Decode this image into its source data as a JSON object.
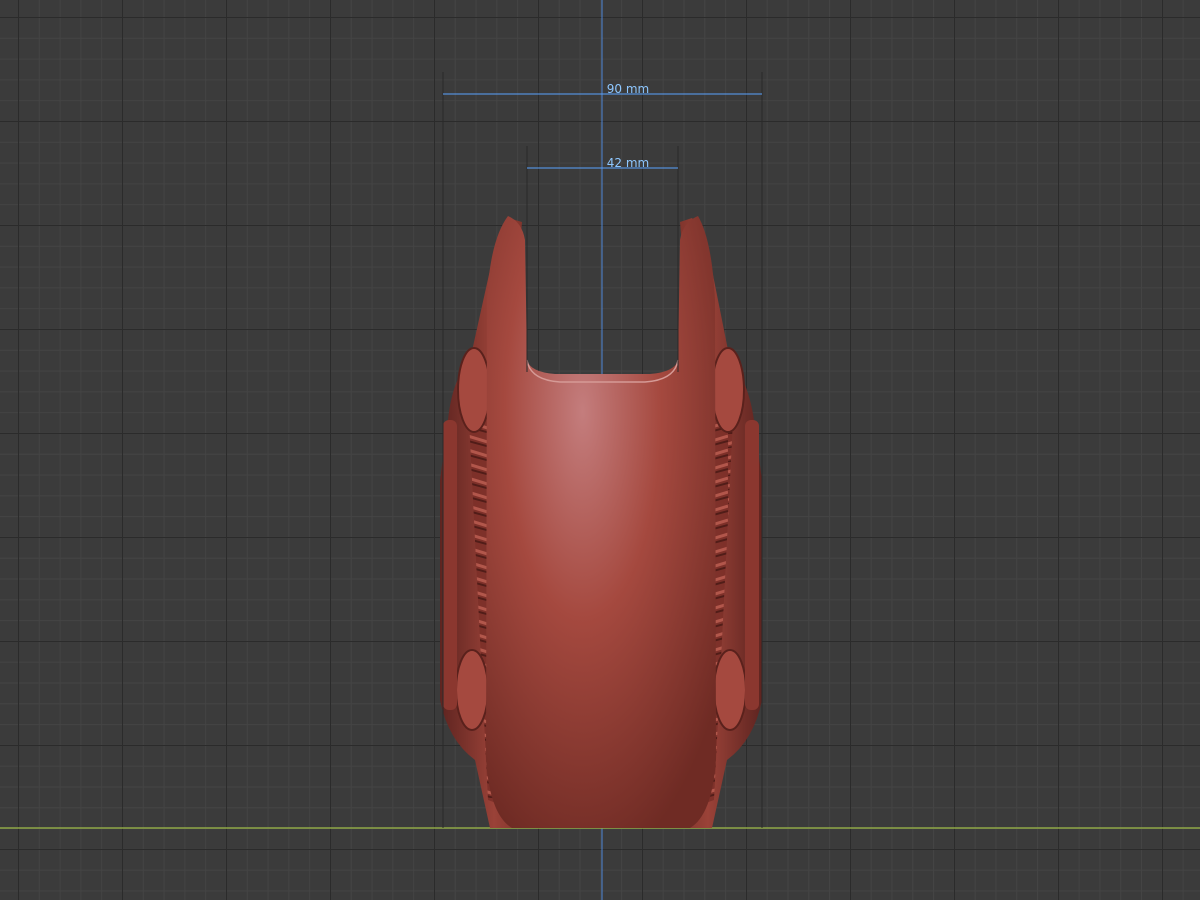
{
  "viewport": {
    "background": "#3b3b3b",
    "grid_minor_color": "#444444",
    "grid_major_color": "#2b2b2b",
    "ground_axis_color": "#8fa846",
    "vertical_axis_color": "#4e86d6"
  },
  "model": {
    "material_color": "#a5493f",
    "highlight_color": "#c47d7d"
  },
  "measurements": {
    "outer_width": {
      "label": "90 mm",
      "color": "#5aa3ff"
    },
    "inner_width": {
      "label": "42 mm",
      "color": "#5aa3ff"
    }
  }
}
